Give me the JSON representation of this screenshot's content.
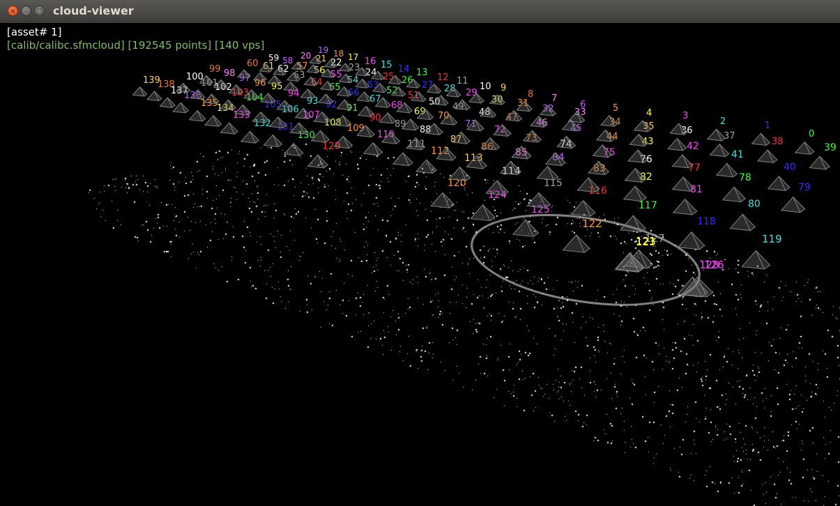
{
  "window": {
    "title": "cloud-viewer",
    "close_glyph": "×",
    "min_glyph": "–",
    "max_glyph": "□"
  },
  "overlay": {
    "asset_label": "[asset# 1]",
    "cloud_info": "[calib/calibc.sfmcloud] [192545 points] [140 vps]"
  },
  "colors": {
    "background": "#000000",
    "points": "#ffffff",
    "frustum": "#808080",
    "info_text": "#7fbf5f"
  },
  "viewpoints": [
    {
      "id": "139",
      "color": "#ffd24d"
    },
    {
      "id": "138",
      "color": "#e07b3a"
    },
    {
      "id": "137",
      "color": "#ffffff"
    },
    {
      "id": "136",
      "color": "#c060ff"
    },
    {
      "id": "135",
      "color": "#ff9a2a"
    },
    {
      "id": "134",
      "color": "#ffff40"
    },
    {
      "id": "133",
      "color": "#ff40ff"
    },
    {
      "id": "132",
      "color": "#40e0e0"
    },
    {
      "id": "131",
      "color": "#3030ff"
    },
    {
      "id": "130",
      "color": "#30ff30"
    },
    {
      "id": "129",
      "color": "#ff3030"
    },
    {
      "id": "128",
      "color": "#ff40ff"
    },
    {
      "id": "127",
      "color": "#a0a0a0"
    },
    {
      "id": "126",
      "color": "#ff40ff"
    },
    {
      "id": "125",
      "color": "#ff40ff"
    },
    {
      "id": "124",
      "color": "#ff40ff"
    },
    {
      "id": "123",
      "color": "#ffff40"
    },
    {
      "id": "122",
      "color": "#ff9a2a"
    },
    {
      "id": "121",
      "color": "#ffff40"
    },
    {
      "id": "120",
      "color": "#ff9a2a"
    },
    {
      "id": "119",
      "color": "#40e0e0"
    },
    {
      "id": "118",
      "color": "#3030ff"
    },
    {
      "id": "117",
      "color": "#30ff30"
    },
    {
      "id": "116",
      "color": "#ff3030"
    },
    {
      "id": "115",
      "color": "#a0a0a0"
    },
    {
      "id": "114",
      "color": "#ffffff"
    },
    {
      "id": "113",
      "color": "#ffd24d"
    },
    {
      "id": "112",
      "color": "#ff9a2a"
    },
    {
      "id": "111",
      "color": "#a0a0a0"
    },
    {
      "id": "110",
      "color": "#ff40ff"
    },
    {
      "id": "109",
      "color": "#ff9a2a"
    },
    {
      "id": "108",
      "color": "#ffff40"
    },
    {
      "id": "107",
      "color": "#ff40ff"
    },
    {
      "id": "106",
      "color": "#40e0e0"
    },
    {
      "id": "105",
      "color": "#3030ff"
    },
    {
      "id": "104",
      "color": "#30ff30"
    },
    {
      "id": "103",
      "color": "#ff3030"
    },
    {
      "id": "102",
      "color": "#ffffff"
    },
    {
      "id": "101",
      "color": "#a0a0a0"
    },
    {
      "id": "100",
      "color": "#ffffff"
    },
    {
      "id": "99",
      "color": "#e07b3a"
    },
    {
      "id": "98",
      "color": "#ff80ff"
    },
    {
      "id": "97",
      "color": "#c060ff"
    },
    {
      "id": "96",
      "color": "#ff9a2a"
    },
    {
      "id": "95",
      "color": "#ffff40"
    },
    {
      "id": "94",
      "color": "#ff40ff"
    },
    {
      "id": "93",
      "color": "#40e0e0"
    },
    {
      "id": "92",
      "color": "#3030ff"
    },
    {
      "id": "91",
      "color": "#30ff30"
    },
    {
      "id": "90",
      "color": "#ff3030"
    },
    {
      "id": "89",
      "color": "#a0a0a0"
    },
    {
      "id": "88",
      "color": "#ffffff"
    },
    {
      "id": "87",
      "color": "#ffd24d"
    },
    {
      "id": "86",
      "color": "#e07b3a"
    },
    {
      "id": "85",
      "color": "#ff80ff"
    },
    {
      "id": "84",
      "color": "#c060ff"
    },
    {
      "id": "83",
      "color": "#ff9a2a"
    },
    {
      "id": "82",
      "color": "#ffff40"
    },
    {
      "id": "81",
      "color": "#ff40ff"
    },
    {
      "id": "80",
      "color": "#40e0e0"
    },
    {
      "id": "79",
      "color": "#3030ff"
    },
    {
      "id": "78",
      "color": "#30ff30"
    },
    {
      "id": "77",
      "color": "#ff3030"
    },
    {
      "id": "76",
      "color": "#ffffff"
    },
    {
      "id": "75",
      "color": "#ff40ff"
    },
    {
      "id": "74",
      "color": "#ffffff"
    },
    {
      "id": "73",
      "color": "#e07b3a"
    },
    {
      "id": "72",
      "color": "#ff40ff"
    },
    {
      "id": "71",
      "color": "#c060ff"
    },
    {
      "id": "70",
      "color": "#ff9a2a"
    },
    {
      "id": "69",
      "color": "#ffff40"
    },
    {
      "id": "68",
      "color": "#ff40ff"
    },
    {
      "id": "67",
      "color": "#40e0e0"
    },
    {
      "id": "66",
      "color": "#3030ff"
    },
    {
      "id": "65",
      "color": "#30ff30"
    },
    {
      "id": "64",
      "color": "#ff3030"
    },
    {
      "id": "63",
      "color": "#a0a0a0"
    },
    {
      "id": "62",
      "color": "#ffffff"
    },
    {
      "id": "61",
      "color": "#ffd24d"
    },
    {
      "id": "60",
      "color": "#e07b3a"
    },
    {
      "id": "59",
      "color": "#ffffff"
    },
    {
      "id": "58",
      "color": "#c060ff"
    },
    {
      "id": "57",
      "color": "#ff9a2a"
    },
    {
      "id": "56",
      "color": "#ffff40"
    },
    {
      "id": "55",
      "color": "#ff40ff"
    },
    {
      "id": "54",
      "color": "#40e0e0"
    },
    {
      "id": "53",
      "color": "#3030ff"
    },
    {
      "id": "52",
      "color": "#30ff30"
    },
    {
      "id": "51",
      "color": "#ff3030"
    },
    {
      "id": "50",
      "color": "#ffffff"
    },
    {
      "id": "49",
      "color": "#a0a0a0"
    },
    {
      "id": "48",
      "color": "#ffffff"
    },
    {
      "id": "47",
      "color": "#e07b3a"
    },
    {
      "id": "46",
      "color": "#ff80ff"
    },
    {
      "id": "45",
      "color": "#c060ff"
    },
    {
      "id": "44",
      "color": "#ff9a2a"
    },
    {
      "id": "43",
      "color": "#ffff40"
    },
    {
      "id": "42",
      "color": "#ff40ff"
    },
    {
      "id": "41",
      "color": "#40e0e0"
    },
    {
      "id": "40",
      "color": "#3030ff"
    },
    {
      "id": "39",
      "color": "#30ff30"
    },
    {
      "id": "38",
      "color": "#ff3030"
    },
    {
      "id": "37",
      "color": "#a0a0a0"
    },
    {
      "id": "36",
      "color": "#ffffff"
    },
    {
      "id": "35",
      "color": "#ffd24d"
    },
    {
      "id": "34",
      "color": "#e07b3a"
    },
    {
      "id": "33",
      "color": "#ff80ff"
    },
    {
      "id": "32",
      "color": "#c060ff"
    },
    {
      "id": "31",
      "color": "#ff9a2a"
    },
    {
      "id": "30",
      "color": "#ffff40"
    },
    {
      "id": "29",
      "color": "#ff40ff"
    },
    {
      "id": "28",
      "color": "#40e0e0"
    },
    {
      "id": "27",
      "color": "#3030ff"
    },
    {
      "id": "26",
      "color": "#30ff30"
    },
    {
      "id": "25",
      "color": "#ff3030"
    },
    {
      "id": "24",
      "color": "#ffffff"
    },
    {
      "id": "23",
      "color": "#a0a0a0"
    },
    {
      "id": "22",
      "color": "#ffffff"
    },
    {
      "id": "21",
      "color": "#ffd24d"
    },
    {
      "id": "20",
      "color": "#ff80ff"
    },
    {
      "id": "19",
      "color": "#c060ff"
    },
    {
      "id": "18",
      "color": "#ff9a2a"
    },
    {
      "id": "17",
      "color": "#ffff40"
    },
    {
      "id": "16",
      "color": "#ff40ff"
    },
    {
      "id": "15",
      "color": "#40e0e0"
    },
    {
      "id": "14",
      "color": "#3030ff"
    },
    {
      "id": "13",
      "color": "#30ff30"
    },
    {
      "id": "12",
      "color": "#ff3030"
    },
    {
      "id": "11",
      "color": "#a0a0a0"
    },
    {
      "id": "10",
      "color": "#ffffff"
    },
    {
      "id": "9",
      "color": "#ffd24d"
    },
    {
      "id": "8",
      "color": "#e07b3a"
    },
    {
      "id": "7",
      "color": "#ff80ff"
    },
    {
      "id": "6",
      "color": "#c060ff"
    },
    {
      "id": "5",
      "color": "#ff9a2a"
    },
    {
      "id": "4",
      "color": "#ffff40"
    },
    {
      "id": "3",
      "color": "#ff40ff"
    },
    {
      "id": "2",
      "color": "#40e0e0"
    },
    {
      "id": "1",
      "color": "#3030ff"
    },
    {
      "id": "0",
      "color": "#30ff30"
    }
  ]
}
